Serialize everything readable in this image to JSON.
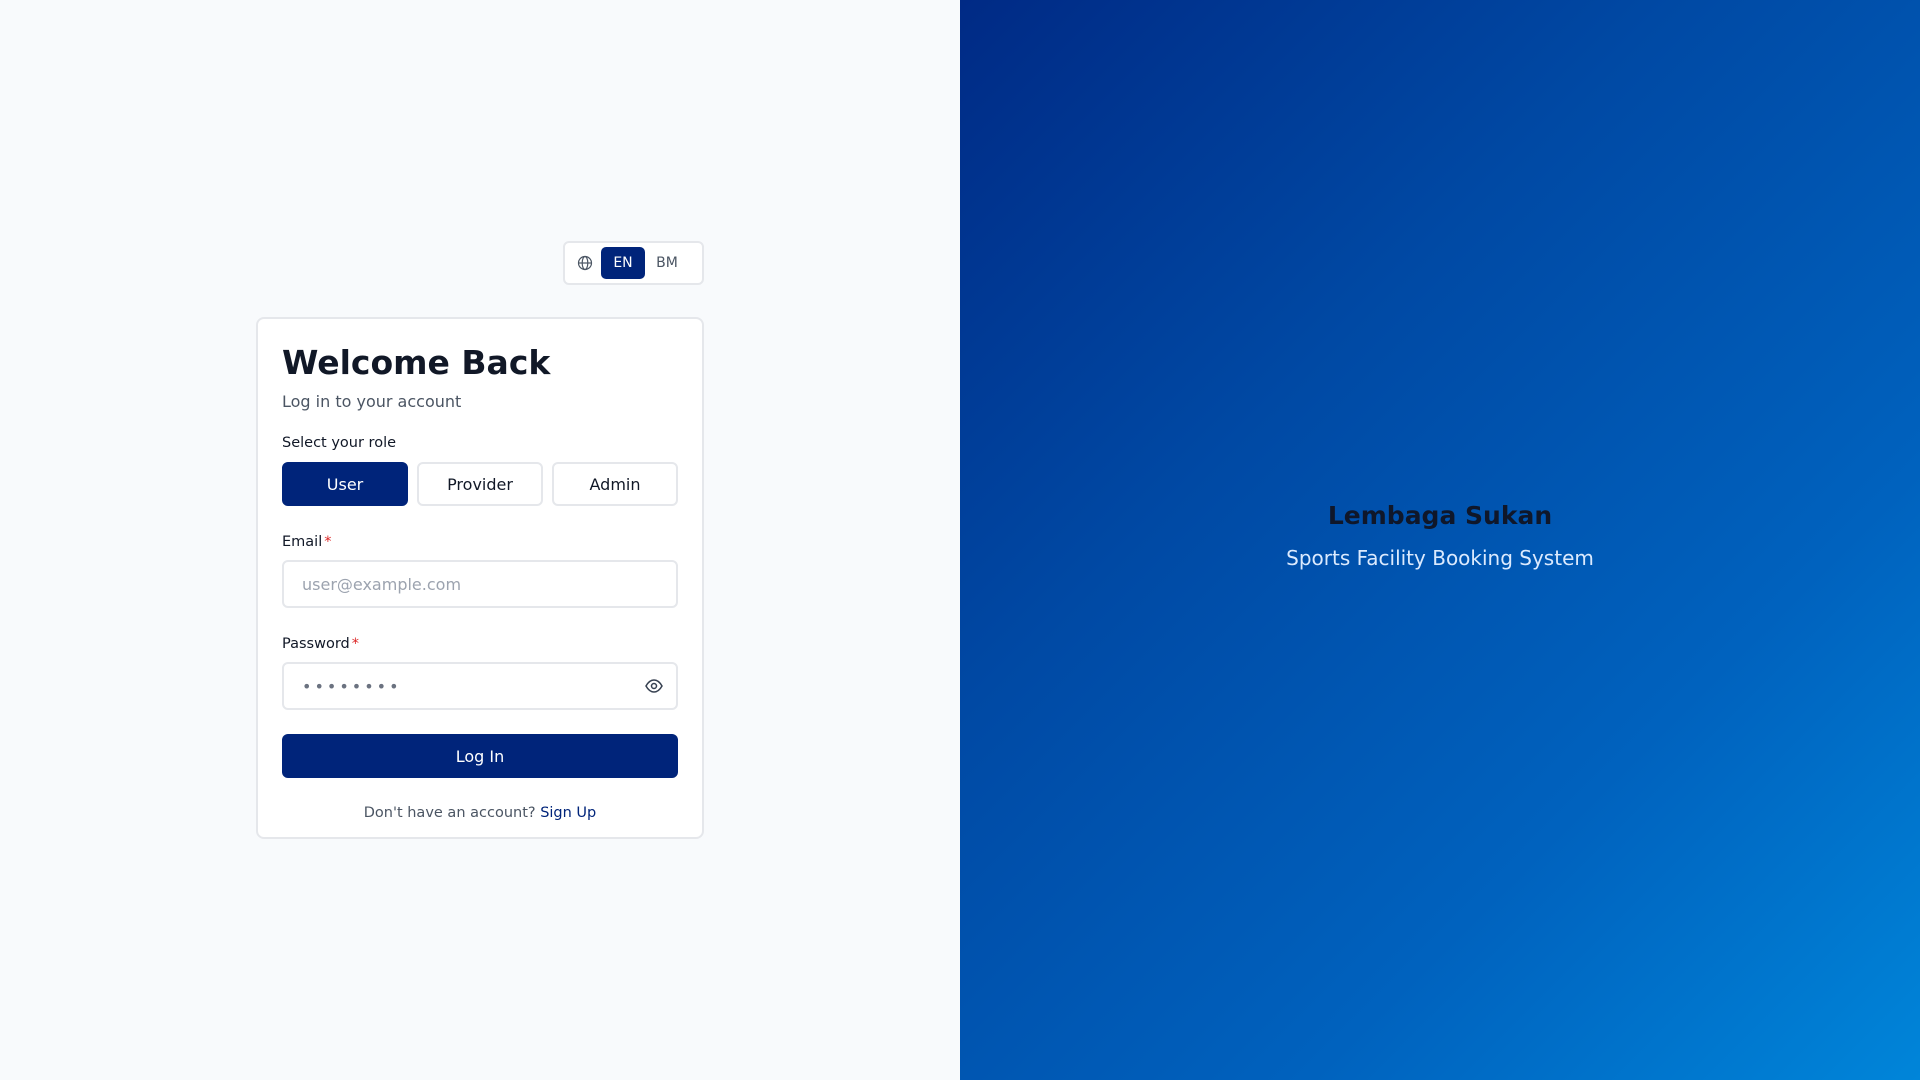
{
  "language_switcher": {
    "icon": "globe-icon",
    "options": [
      {
        "label": "EN",
        "active": true
      },
      {
        "label": "BM",
        "active": false
      }
    ]
  },
  "login_card": {
    "title": "Welcome Back",
    "subtitle": "Log in to your account",
    "role_label": "Select your role",
    "roles": [
      {
        "label": "User",
        "active": true
      },
      {
        "label": "Provider",
        "active": false
      },
      {
        "label": "Admin",
        "active": false
      }
    ],
    "email": {
      "label": "Email",
      "required_mark": "*",
      "placeholder": "user@example.com",
      "value": ""
    },
    "password": {
      "label": "Password",
      "required_mark": "*",
      "value": "••••••••",
      "toggle_icon": "eye-icon"
    },
    "submit_label": "Log In",
    "signup_prompt": "Don't have an account?",
    "signup_link": "Sign Up"
  },
  "brand": {
    "title": "Lembaga Sukan",
    "subtitle": "Sports Facility Booking System"
  },
  "colors": {
    "primary": "#00247a",
    "required": "#dc2626",
    "left_background": "#f8fafc",
    "gradient_start": "#002a85",
    "gradient_end": "#0085d9"
  }
}
